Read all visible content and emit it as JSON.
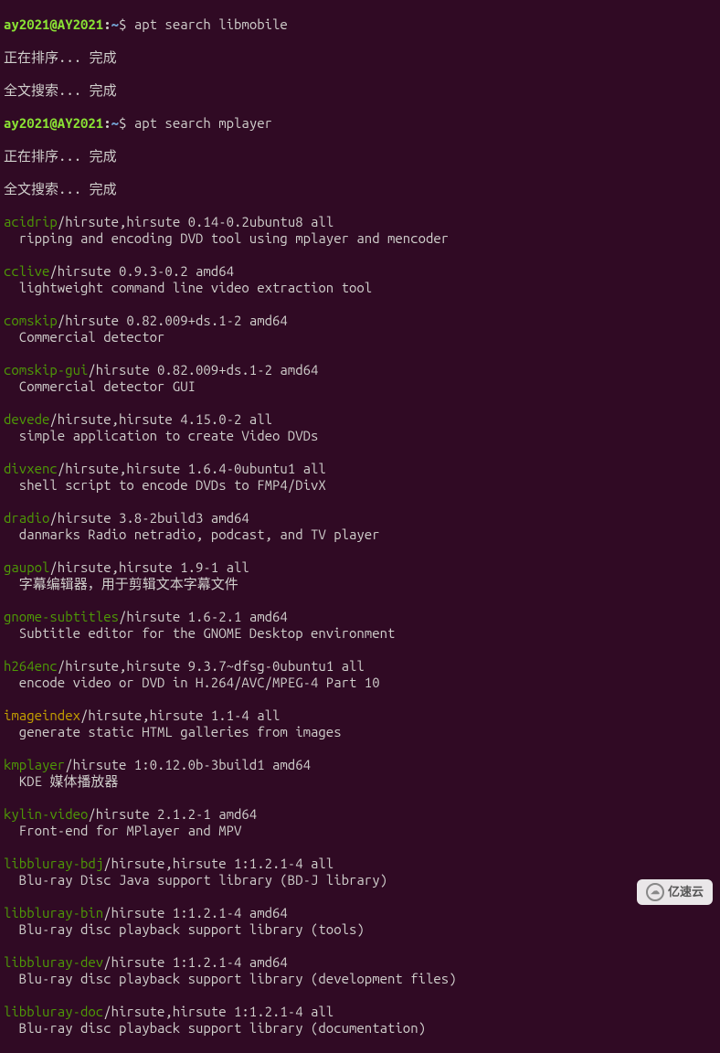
{
  "prompt": {
    "user": "ay2021@AY2021",
    "sep": ":",
    "path": "~",
    "dollar": "$"
  },
  "cmds": {
    "search1": " apt search libmobile",
    "search2": " apt search mplayer"
  },
  "status": {
    "sorting": "正在排序... 完成",
    "fulltext": "全文搜索... 完成"
  },
  "packages": [
    {
      "name": "acidrip",
      "info": "/hirsute,hirsute 0.14-0.2ubuntu8 all",
      "desc": "  ripping and encoding DVD tool using mplayer and mencoder",
      "highlight": false
    },
    {
      "name": "cclive",
      "info": "/hirsute 0.9.3-0.2 amd64",
      "desc": "  lightweight command line video extraction tool",
      "highlight": false
    },
    {
      "name": "comskip",
      "info": "/hirsute 0.82.009+ds.1-2 amd64",
      "desc": "  Commercial detector",
      "highlight": false
    },
    {
      "name": "comskip-gui",
      "info": "/hirsute 0.82.009+ds.1-2 amd64",
      "desc": "  Commercial detector GUI",
      "highlight": false
    },
    {
      "name": "devede",
      "info": "/hirsute,hirsute 4.15.0-2 all",
      "desc": "  simple application to create Video DVDs",
      "highlight": false
    },
    {
      "name": "divxenc",
      "info": "/hirsute,hirsute 1.6.4-0ubuntu1 all",
      "desc": "  shell script to encode DVDs to FMP4/DivX",
      "highlight": false
    },
    {
      "name": "dradio",
      "info": "/hirsute 3.8-2build3 amd64",
      "desc": "  danmarks Radio netradio, podcast, and TV player",
      "highlight": false
    },
    {
      "name": "gaupol",
      "info": "/hirsute,hirsute 1.9-1 all",
      "desc": "  字幕编辑器，用于剪辑文本字幕文件",
      "highlight": false
    },
    {
      "name": "gnome-subtitles",
      "info": "/hirsute 1.6-2.1 amd64",
      "desc": "  Subtitle editor for the GNOME Desktop environment",
      "highlight": false
    },
    {
      "name": "h264enc",
      "info": "/hirsute,hirsute 9.3.7~dfsg-0ubuntu1 all",
      "desc": "  encode video or DVD in H.264/AVC/MPEG-4 Part 10",
      "highlight": false
    },
    {
      "name": "imageindex",
      "info": "/hirsute,hirsute 1.1-4 all",
      "desc": "  generate static HTML galleries from images",
      "highlight": true
    },
    {
      "name": "kmplayer",
      "info": "/hirsute 1:0.12.0b-3build1 amd64",
      "desc": "  KDE 媒体播放器",
      "highlight": false
    },
    {
      "name": "kylin-video",
      "info": "/hirsute 2.1.2-1 amd64",
      "desc": "  Front-end for MPlayer and MPV",
      "highlight": false
    },
    {
      "name": "libbluray-bdj",
      "info": "/hirsute,hirsute 1:1.2.1-4 all",
      "desc": "  Blu-ray Disc Java support library (BD-J library)",
      "highlight": false
    },
    {
      "name": "libbluray-bin",
      "info": "/hirsute 1:1.2.1-4 amd64",
      "desc": "  Blu-ray disc playback support library (tools)",
      "highlight": false
    },
    {
      "name": "libbluray-dev",
      "info": "/hirsute 1:1.2.1-4 amd64",
      "desc": "  Blu-ray disc playback support library (development files)",
      "highlight": false
    },
    {
      "name": "libbluray-doc",
      "info": "/hirsute,hirsute 1:1.2.1-4 all",
      "desc": "  Blu-ray disc playback support library (documentation)",
      "highlight": false
    }
  ],
  "watermark": "亿速云"
}
